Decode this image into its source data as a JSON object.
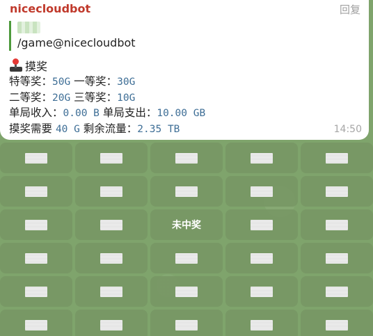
{
  "message": {
    "sender": "nicecloudbot",
    "reply_label": "回复",
    "command": "/game@nicecloudbot",
    "title": "摸奖",
    "title_icon": "joystick-icon",
    "lines": [
      {
        "parts": [
          {
            "t": "特等奖："
          },
          {
            "t": "50G",
            "m": true
          },
          {
            "t": " 一等奖："
          },
          {
            "t": "30G",
            "m": true
          }
        ]
      },
      {
        "parts": [
          {
            "t": "二等奖："
          },
          {
            "t": "20G",
            "m": true
          },
          {
            "t": " 三等奖："
          },
          {
            "t": "10G",
            "m": true
          }
        ]
      },
      {
        "parts": [
          {
            "t": "单局收入："
          },
          {
            "t": "0.00 B",
            "m": true
          },
          {
            "t": " 单局支出："
          },
          {
            "t": "10.00 GB",
            "m": true
          }
        ]
      },
      {
        "parts": [
          {
            "t": "摸奖需要 "
          },
          {
            "t": "40 G",
            "m": true
          },
          {
            "t": " 剩余流量："
          },
          {
            "t": "2.35 TB",
            "m": true
          }
        ]
      }
    ],
    "time": "14:50"
  },
  "keyboard": {
    "rows": [
      [
        "",
        "",
        "",
        "",
        ""
      ],
      [
        "",
        "",
        "",
        "",
        ""
      ],
      [
        "",
        "",
        "未中奖",
        "",
        ""
      ],
      [
        "",
        "",
        "",
        "",
        ""
      ],
      [
        "",
        "",
        "",
        "",
        ""
      ],
      [
        "",
        "",
        "",
        "",
        ""
      ]
    ]
  }
}
